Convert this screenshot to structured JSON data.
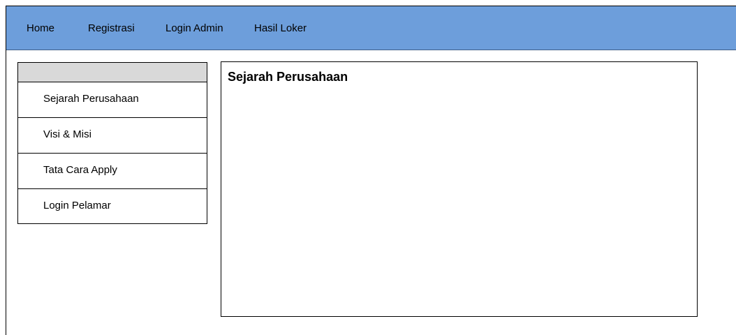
{
  "nav": {
    "home": "Home",
    "registrasi": "Registrasi",
    "login_admin": "Login Admin",
    "hasil_loker": "Hasil Loker"
  },
  "sidebar": {
    "items": [
      {
        "label": "Sejarah Perusahaan"
      },
      {
        "label": "Visi & Misi"
      },
      {
        "label": "Tata Cara Apply"
      },
      {
        "label": "Login Pelamar"
      }
    ]
  },
  "content": {
    "title": "Sejarah Perusahaan"
  },
  "colors": {
    "nav_background": "#6d9edb",
    "sidebar_header": "#d9d9d9"
  }
}
